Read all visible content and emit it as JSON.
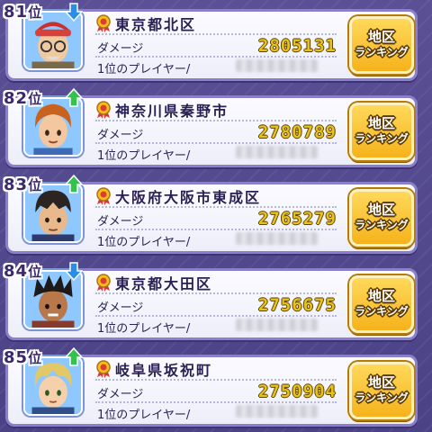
{
  "colors": {
    "up": "#33c24a",
    "down": "#2a8de6"
  },
  "rows": [
    {
      "rank": "81",
      "suffix": "位",
      "trend": "down",
      "area": "東京都北区",
      "damage_label": "ダメージ",
      "score": "2805131",
      "player_label": "1位のプレイヤー/",
      "button_line1": "地区",
      "button_line2": "ランキング"
    },
    {
      "rank": "82",
      "suffix": "位",
      "trend": "up",
      "area": "神奈川県秦野市",
      "damage_label": "ダメージ",
      "score": "2780789",
      "player_label": "1位のプレイヤー/",
      "button_line1": "地区",
      "button_line2": "ランキング"
    },
    {
      "rank": "83",
      "suffix": "位",
      "trend": "up",
      "area": "大阪府大阪市東成区",
      "damage_label": "ダメージ",
      "score": "2765279",
      "player_label": "1位のプレイヤー/",
      "button_line1": "地区",
      "button_line2": "ランキング"
    },
    {
      "rank": "84",
      "suffix": "位",
      "trend": "down",
      "area": "東京都大田区",
      "damage_label": "ダメージ",
      "score": "2756675",
      "player_label": "1位のプレイヤー/",
      "button_line1": "地区",
      "button_line2": "ランキング"
    },
    {
      "rank": "85",
      "suffix": "位",
      "trend": "up",
      "area": "岐阜県坂祝町",
      "damage_label": "ダメージ",
      "score": "2750904",
      "player_label": "1位のプレイヤー/",
      "button_line1": "地区",
      "button_line2": "ランキング"
    }
  ]
}
